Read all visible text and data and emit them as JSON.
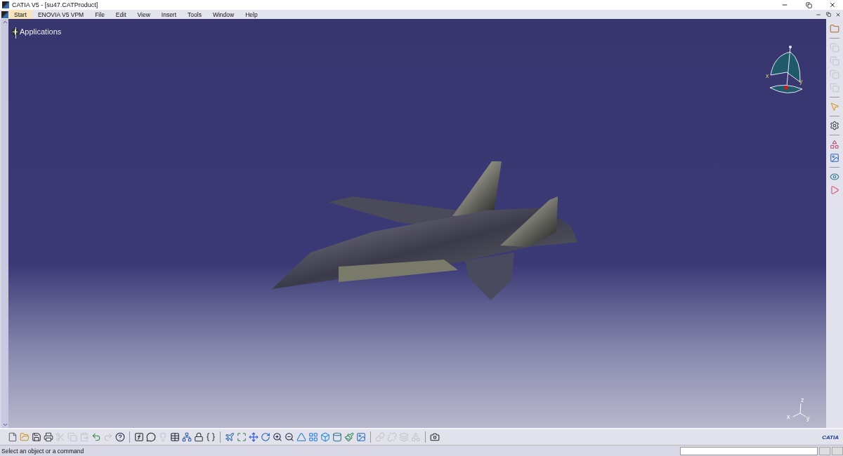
{
  "window": {
    "title": "CATIA V5 - [su47.CATProduct]"
  },
  "menu": [
    {
      "label": "Start",
      "selected": true
    },
    {
      "label": "ENOVIA V5 VPM",
      "selected": false
    },
    {
      "label": "File",
      "selected": false
    },
    {
      "label": "Edit",
      "selected": false
    },
    {
      "label": "View",
      "selected": false
    },
    {
      "label": "Insert",
      "selected": false
    },
    {
      "label": "Tools",
      "selected": false
    },
    {
      "label": "Window",
      "selected": false
    },
    {
      "label": "Help",
      "selected": false
    }
  ],
  "tree": {
    "items": [
      {
        "label": "Applications",
        "expanded": false
      }
    ]
  },
  "compass": {
    "axis_labels": [
      "x",
      "y"
    ]
  },
  "axis_triad": {
    "labels": [
      "z",
      "x",
      "y"
    ]
  },
  "right_toolbar": [
    {
      "kind": "folder",
      "disabled": false
    },
    {
      "kind": "sep"
    },
    {
      "kind": "copy",
      "disabled": true
    },
    {
      "kind": "copy",
      "disabled": true
    },
    {
      "kind": "copy",
      "disabled": true
    },
    {
      "kind": "copy",
      "disabled": true
    },
    {
      "kind": "sep"
    },
    {
      "kind": "pointer",
      "disabled": false
    },
    {
      "kind": "sep"
    },
    {
      "kind": "settings",
      "disabled": false
    },
    {
      "kind": "sep"
    },
    {
      "kind": "shapes",
      "disabled": false
    },
    {
      "kind": "image",
      "disabled": false
    },
    {
      "kind": "sep"
    },
    {
      "kind": "eye",
      "disabled": false
    },
    {
      "kind": "play",
      "disabled": false
    }
  ],
  "bottom_toolbar": [
    {
      "kind": "new",
      "disabled": false
    },
    {
      "kind": "open",
      "disabled": false
    },
    {
      "kind": "save",
      "disabled": false
    },
    {
      "kind": "print",
      "disabled": false
    },
    {
      "kind": "cut",
      "disabled": true
    },
    {
      "kind": "copy",
      "disabled": true
    },
    {
      "kind": "paste",
      "disabled": true
    },
    {
      "kind": "undo",
      "disabled": false
    },
    {
      "kind": "redo",
      "disabled": true
    },
    {
      "kind": "help",
      "disabled": false
    },
    {
      "kind": "sep"
    },
    {
      "kind": "formula",
      "disabled": false
    },
    {
      "kind": "comment",
      "disabled": false
    },
    {
      "kind": "bulb",
      "disabled": true
    },
    {
      "kind": "table",
      "disabled": false
    },
    {
      "kind": "tree",
      "disabled": false
    },
    {
      "kind": "lock",
      "disabled": false
    },
    {
      "kind": "braces",
      "disabled": false
    },
    {
      "kind": "sep"
    },
    {
      "kind": "fly",
      "disabled": false
    },
    {
      "kind": "fit",
      "disabled": false
    },
    {
      "kind": "pan",
      "disabled": false
    },
    {
      "kind": "rotate",
      "disabled": false
    },
    {
      "kind": "zoomin",
      "disabled": false
    },
    {
      "kind": "zoomout",
      "disabled": false
    },
    {
      "kind": "normal",
      "disabled": false
    },
    {
      "kind": "grid",
      "disabled": false
    },
    {
      "kind": "box",
      "disabled": false
    },
    {
      "kind": "cylinder",
      "disabled": false
    },
    {
      "kind": "brush",
      "disabled": false
    },
    {
      "kind": "image",
      "disabled": false
    },
    {
      "kind": "sep"
    },
    {
      "kind": "link",
      "disabled": true
    },
    {
      "kind": "unlink",
      "disabled": true
    },
    {
      "kind": "layers",
      "disabled": true
    },
    {
      "kind": "shapes",
      "disabled": true
    },
    {
      "kind": "sep"
    },
    {
      "kind": "camera",
      "disabled": false
    }
  ],
  "logo": {
    "text": "CATIA"
  },
  "status_bar": {
    "message": "Select an object or a command"
  }
}
